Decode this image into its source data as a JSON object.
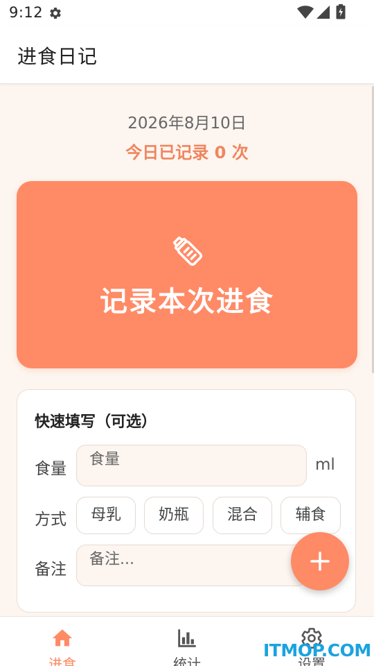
{
  "status_bar": {
    "time": "9:12"
  },
  "app_bar": {
    "title": "进食日记"
  },
  "summary": {
    "date": "2026年8月10日",
    "count_text": "今日已记录 0 次"
  },
  "record_button": {
    "label": "记录本次进食",
    "icon": "baby-bottle-icon"
  },
  "quick_fill": {
    "title": "快速填写（可选）",
    "amount": {
      "label": "食量",
      "placeholder": "食量",
      "value": "",
      "unit": "ml"
    },
    "method": {
      "label": "方式",
      "options": [
        "母乳",
        "奶瓶",
        "混合",
        "辅食"
      ]
    },
    "note": {
      "label": "备注",
      "placeholder": "备注...",
      "value": ""
    }
  },
  "fab": {
    "icon": "plus-icon"
  },
  "bottom_nav": {
    "items": [
      {
        "label": "进食",
        "icon": "home-icon",
        "active": true
      },
      {
        "label": "统计",
        "icon": "bar-chart-icon",
        "active": false
      },
      {
        "label": "设置",
        "icon": "gear-icon",
        "active": false
      }
    ]
  },
  "watermark": "ITMOP.COM",
  "colors": {
    "accent": "#ff8a66",
    "accent_text": "#f0855f",
    "background": "#fdf5ef",
    "nav_inactive": "#555555",
    "watermark": "#1aa3e0"
  }
}
